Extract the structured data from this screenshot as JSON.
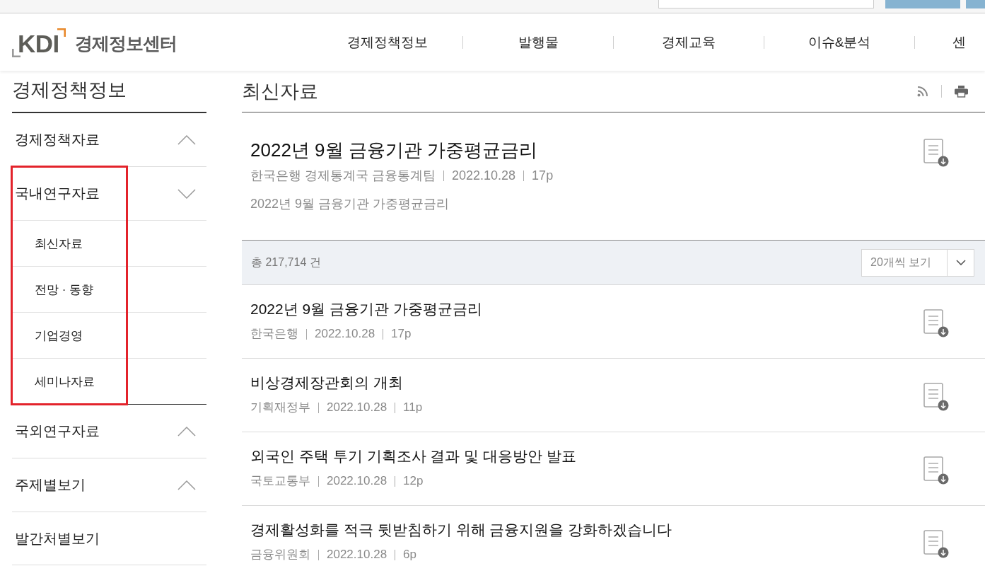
{
  "header": {
    "logo": {
      "mark": "KDI",
      "name": "경제정보센터"
    },
    "nav": [
      {
        "label": "경제정책정보"
      },
      {
        "label": "발행물"
      },
      {
        "label": "경제교육"
      },
      {
        "label": "이슈&분석"
      },
      {
        "label": "센"
      }
    ]
  },
  "sidebar": {
    "title": "경제정책정보",
    "items": [
      {
        "kind": "group",
        "label": "경제정책자료",
        "expanded": false,
        "highlighted": false
      },
      {
        "kind": "group",
        "label": "국내연구자료",
        "expanded": true,
        "highlighted": true,
        "children": [
          {
            "label": "최신자료"
          },
          {
            "label": "전망 · 동향"
          },
          {
            "label": "기업경영"
          },
          {
            "label": "세미나자료"
          }
        ]
      },
      {
        "kind": "group",
        "label": "국외연구자료",
        "expanded": false,
        "highlighted": false
      },
      {
        "kind": "group",
        "label": "주제별보기",
        "expanded": false,
        "highlighted": false
      },
      {
        "kind": "link",
        "label": "발간처별보기",
        "highlighted": false
      }
    ]
  },
  "main": {
    "title": "최신자료",
    "featured": {
      "title": "2022년 9월 금융기관 가중평균금리",
      "meta": [
        "한국은행 경제통계국 금융통계팀",
        "2022.10.28",
        "17p"
      ],
      "summary": "2022년 9월 금융기관 가중평균금리"
    },
    "count": "총 217,714 건",
    "page_size": "20개씩 보기",
    "items": [
      {
        "title": "2022년 9월 금융기관 가중평균금리",
        "meta": [
          "한국은행",
          "2022.10.28",
          "17p"
        ]
      },
      {
        "title": "비상경제장관회의 개최",
        "meta": [
          "기획재정부",
          "2022.10.28",
          "11p"
        ]
      },
      {
        "title": "외국인 주택 투기 기획조사 결과 및 대응방안 발표",
        "meta": [
          "국토교통부",
          "2022.10.28",
          "12p"
        ]
      },
      {
        "title": "경제활성화를 적극 뒷받침하기 위해 금융지원을 강화하겠습니다",
        "meta": [
          "금융위원회",
          "2022.10.28",
          "6p"
        ]
      }
    ]
  }
}
